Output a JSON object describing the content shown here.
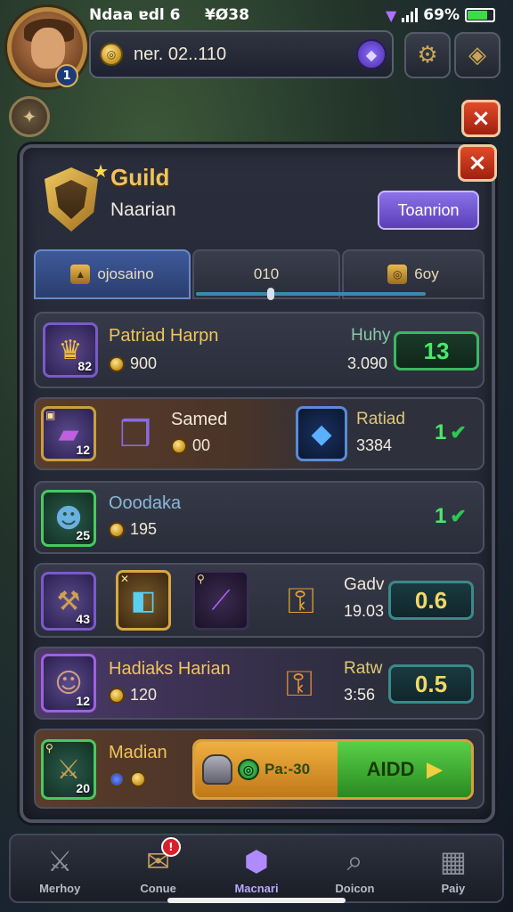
{
  "status": {
    "carrier": "Ndaa ɐdl",
    "signal_extra": "6",
    "clock": "¥Ø38",
    "battery": "69%"
  },
  "player": {
    "level": "1",
    "name": "ner. 02..110"
  },
  "close_label": "×",
  "guild": {
    "title": "Guild",
    "subtitle": "Naarian",
    "action_label": "Toanrion"
  },
  "tabs": [
    {
      "label": "ojosaino"
    },
    {
      "label": "010"
    },
    {
      "label": "6oy"
    }
  ],
  "rows": {
    "r1": {
      "title": "Patriad Harpn",
      "level": "82",
      "amount": "900",
      "label": "Huhy",
      "value": "3.090",
      "count": "13"
    },
    "r2": {
      "level": "12",
      "title": "Samed",
      "amount": "00",
      "label": "Ratiad",
      "value": "3384",
      "count": "1"
    },
    "r3": {
      "title": "Ooodaka",
      "level": "25",
      "amount": "195",
      "count": "1"
    },
    "r4": {
      "tile_a_level": "43",
      "label": "Gadv",
      "value": "19.03",
      "count": "0.6"
    },
    "r5": {
      "title": "Hadiaks Harian",
      "level": "12",
      "amount": "120",
      "label": "Ratw",
      "value": "3:56",
      "count": "0.5"
    },
    "r6": {
      "title": "Madian",
      "level": "20",
      "buy_price": "Pa:-30",
      "buy_label": "AIDD"
    }
  },
  "nav": [
    {
      "label": "Merhoy"
    },
    {
      "label": "Conue",
      "badge": "!"
    },
    {
      "label": "Macnari"
    },
    {
      "label": "Doicon"
    },
    {
      "label": "Paiy"
    }
  ]
}
